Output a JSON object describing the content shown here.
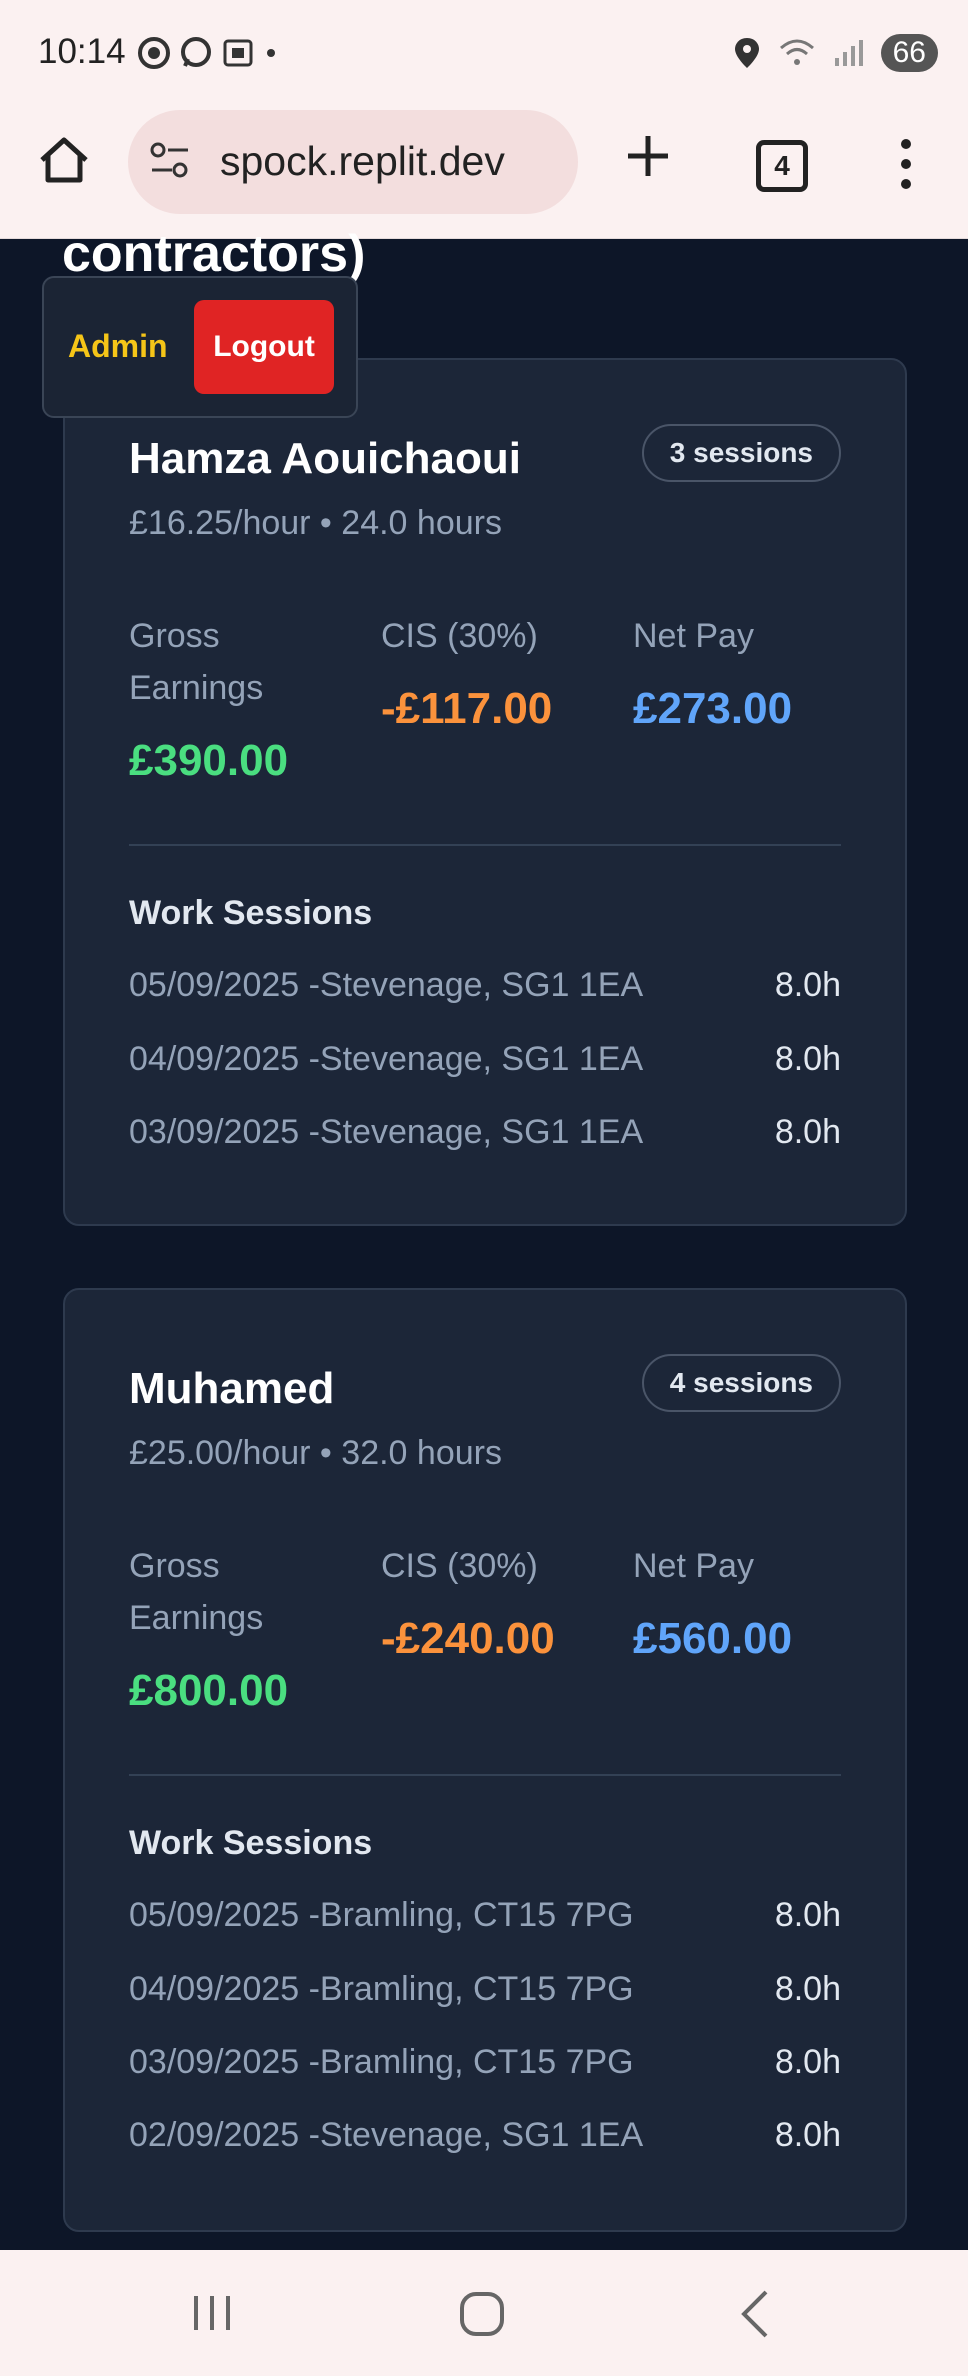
{
  "status": {
    "time": "10:14",
    "battery": "66"
  },
  "browser": {
    "url": "spock.replit.dev",
    "tab_count": "4"
  },
  "page": {
    "heading": "contractors)"
  },
  "nav": {
    "admin": "Admin",
    "logout": "Logout"
  },
  "contractors": [
    {
      "name": "Hamza Aouichaoui",
      "sessions_badge": "3 sessions",
      "rate": "£16.25/hour • 24.0 hours",
      "gross_label_1": "Gross",
      "gross_label_2": "Earnings",
      "gross": "£390.00",
      "cis_label": "CIS (30%)",
      "cis": "-£117.00",
      "net_label": "Net Pay",
      "net": "£273.00",
      "sessions_title": "Work Sessions",
      "sessions": [
        {
          "desc": "05/09/2025 -Stevenage, SG1 1EA",
          "hours": "8.0h"
        },
        {
          "desc": "04/09/2025 -Stevenage, SG1 1EA",
          "hours": "8.0h"
        },
        {
          "desc": "03/09/2025 -Stevenage, SG1 1EA",
          "hours": "8.0h"
        }
      ]
    },
    {
      "name": "Muhamed",
      "sessions_badge": "4 sessions",
      "rate": "£25.00/hour • 32.0 hours",
      "gross_label_1": "Gross",
      "gross_label_2": "Earnings",
      "gross": "£800.00",
      "cis_label": "CIS (30%)",
      "cis": "-£240.00",
      "net_label": "Net Pay",
      "net": "£560.00",
      "sessions_title": "Work Sessions",
      "sessions": [
        {
          "desc": "05/09/2025 -Bramling, CT15 7PG",
          "hours": "8.0h"
        },
        {
          "desc": "04/09/2025 -Bramling, CT15 7PG",
          "hours": "8.0h"
        },
        {
          "desc": "03/09/2025 -Bramling, CT15 7PG",
          "hours": "8.0h"
        },
        {
          "desc": "02/09/2025 -Stevenage, SG1 1EA",
          "hours": "8.0h"
        }
      ]
    }
  ],
  "colors": {
    "background": "#0d1628",
    "card": "#1c2638",
    "gross": "#4ade80",
    "cis": "#fb923c",
    "net": "#60a5fa",
    "admin": "#f5c518",
    "logout": "#e02424"
  }
}
